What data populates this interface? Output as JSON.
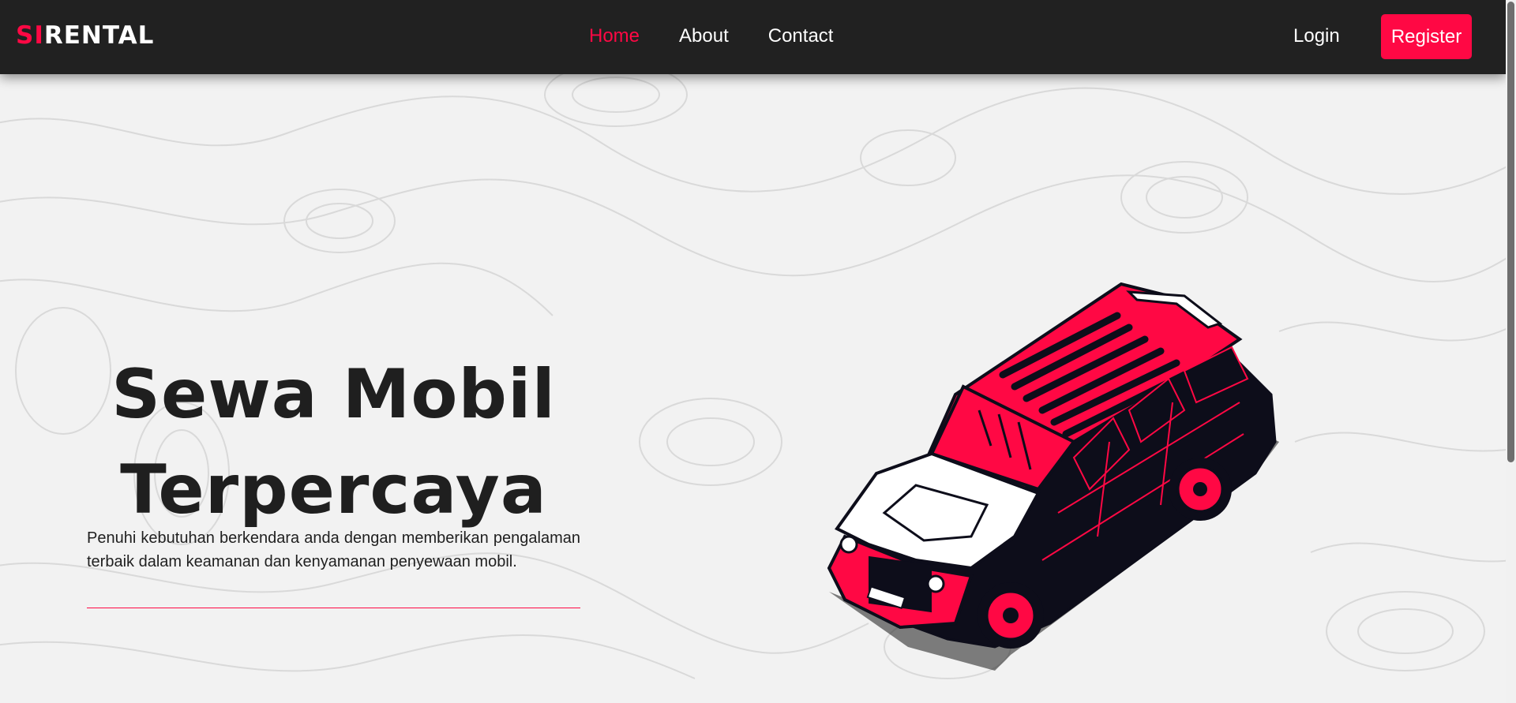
{
  "brand": {
    "accent": "SI",
    "rest": "RENTAL"
  },
  "nav": {
    "links": [
      {
        "label": "Home",
        "active": true
      },
      {
        "label": "About",
        "active": false
      },
      {
        "label": "Contact",
        "active": false
      }
    ],
    "login_label": "Login",
    "register_label": "Register"
  },
  "hero": {
    "title_line1": "Sewa Mobil",
    "title_line2": "Terpercaya",
    "description": "Penuhi kebutuhan berkendara anda dengan memberikan pengalaman terbaik dalam keamanan dan kenyamanan penyewaan mobil."
  },
  "colors": {
    "accent": "#ff0844",
    "navbar": "#212121",
    "background": "#f2f2f2",
    "text": "#1f1f1f"
  },
  "icons": {
    "hero_illustration": "suv-car-illustration"
  }
}
